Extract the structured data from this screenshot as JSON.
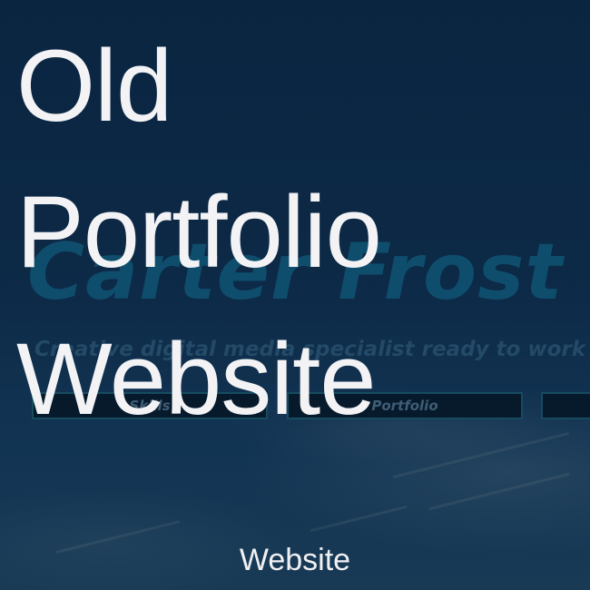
{
  "card": {
    "title_lines": [
      "Old",
      "Portfolio",
      "Website"
    ],
    "caption": "Website"
  },
  "background_site": {
    "name": "Carter Frost",
    "tagline": "Creative digital media specialist ready to work",
    "nav": [
      {
        "label": "Skills"
      },
      {
        "label": "Portfolio"
      },
      {
        "label": ""
      }
    ]
  },
  "colors": {
    "overlay_text": "#f3f3f5",
    "background": "#0e2a44",
    "name_accent": "#0f4d6c",
    "button_border": "#164b60"
  }
}
